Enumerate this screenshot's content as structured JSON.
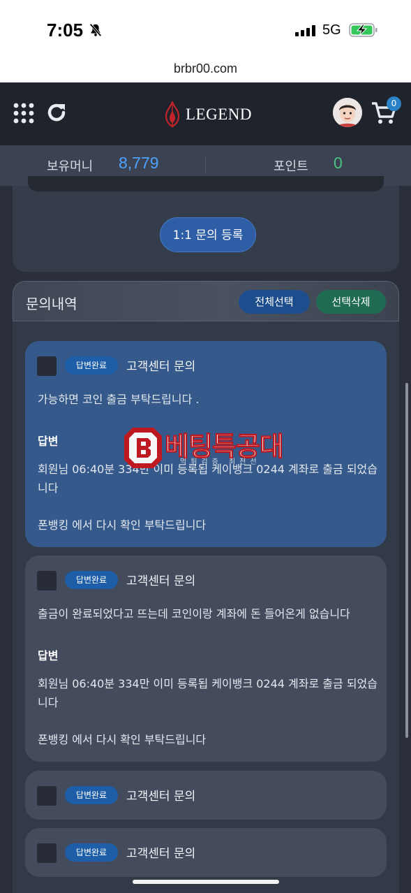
{
  "status_bar": {
    "time": "7:05",
    "network": "5G"
  },
  "browser": {
    "url": "brbr00.com"
  },
  "header": {
    "logo_text": "LEGEND",
    "cart_count": "0"
  },
  "balance": {
    "money_label": "보유머니",
    "money_value": "8,779",
    "point_label": "포인트",
    "point_value": "0"
  },
  "inquiry": {
    "register_button": "1:1 문의 등록"
  },
  "history": {
    "title": "문의내역",
    "select_all_button": "전체선택",
    "delete_selected_button": "선택삭제",
    "items": [
      {
        "badge": "답변완료",
        "title": "고객센터 문의",
        "question": "가능하면 코인 출금 부탁드립니다 .",
        "answer_label": "답변",
        "answer_line1": "회원님 06:40분 334만 이미 등록됩 케이뱅크 0244 계좌로 출금 되었습니다",
        "answer_line2": "폰뱅킹 에서 다시 확인 부탁드립니다"
      },
      {
        "badge": "답변완료",
        "title": "고객센터 문의",
        "question": "출금이 완료되었다고 뜨는데 코인이랑 계좌에 돈 들어온게 없습니다",
        "answer_label": "답변",
        "answer_line1": "회원님 06:40분 334만 이미 등록됩 케이뱅크 0244 계좌로 출금 되었습니다",
        "answer_line2": "폰뱅킹 에서 다시 확인 부탁드립니다"
      },
      {
        "badge": "답변완료",
        "title": "고객센터 문의"
      },
      {
        "badge": "답변완료",
        "title": "고객센터 문의"
      }
    ]
  },
  "watermark": {
    "text": "베팅특공대",
    "sub": "먹튀검증 최전선"
  },
  "colors": {
    "header_bg": "#1f232b",
    "money_accent": "#4fa3ff",
    "point_accent": "#49c283",
    "active_item_bg": "#34598a",
    "item_bg": "#434b5c",
    "badge_bg": "#1e5ea8"
  },
  "icons": [
    "bell-slash-icon",
    "signal-icon",
    "battery-charging-icon",
    "grid-menu-icon",
    "refresh-icon",
    "flame-logo-icon",
    "avatar",
    "cart-icon"
  ]
}
